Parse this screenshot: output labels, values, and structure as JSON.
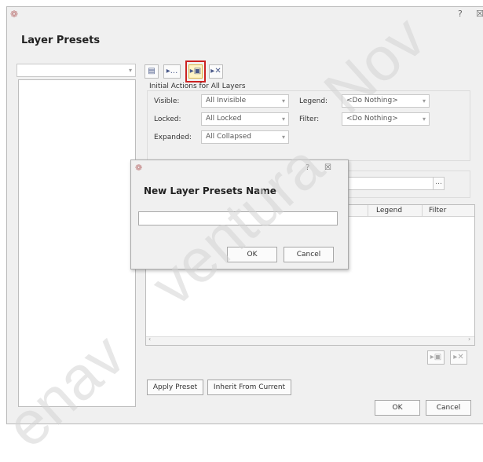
{
  "main_window": {
    "title": "Layer Presets",
    "help_glyph": "?",
    "close_glyph": "☒",
    "logo_glyph": "❁"
  },
  "toolbar": {
    "item1": "▤",
    "item2": "▸...",
    "item3": "▸▣",
    "item4": "▸✕"
  },
  "initial_actions": {
    "group_title": "Initial Actions for All Layers",
    "visible_label": "Visible:",
    "visible_value": "All Invisible",
    "locked_label": "Locked:",
    "locked_value": "All Locked",
    "expanded_label": "Expanded:",
    "expanded_value": "All Collapsed",
    "legend_label": "Legend:",
    "legend_value": "<Do Nothing>",
    "filter_label": "Filter:",
    "filter_value": "<Do Nothing>"
  },
  "grid": {
    "col_legend": "Legend",
    "col_filter": "Filter"
  },
  "row_buttons": {
    "move_glyph": "▸▣",
    "delete_glyph": "▸✕"
  },
  "bottom": {
    "apply_preset": "Apply Preset",
    "inherit_from_current": "Inherit From Current",
    "ok": "OK",
    "cancel": "Cancel"
  },
  "dialog": {
    "title": "New Layer Presets Name",
    "input_value": "",
    "ok": "OK",
    "cancel": "Cancel",
    "help_glyph": "?",
    "close_glyph": "☒",
    "logo_glyph": "❁"
  },
  "watermark": {
    "text1": "Nov",
    "text2": "ventura",
    "text3": "enav"
  },
  "colors": {
    "accent_red": "#cc2222",
    "window_bg": "#f0f0f0"
  }
}
